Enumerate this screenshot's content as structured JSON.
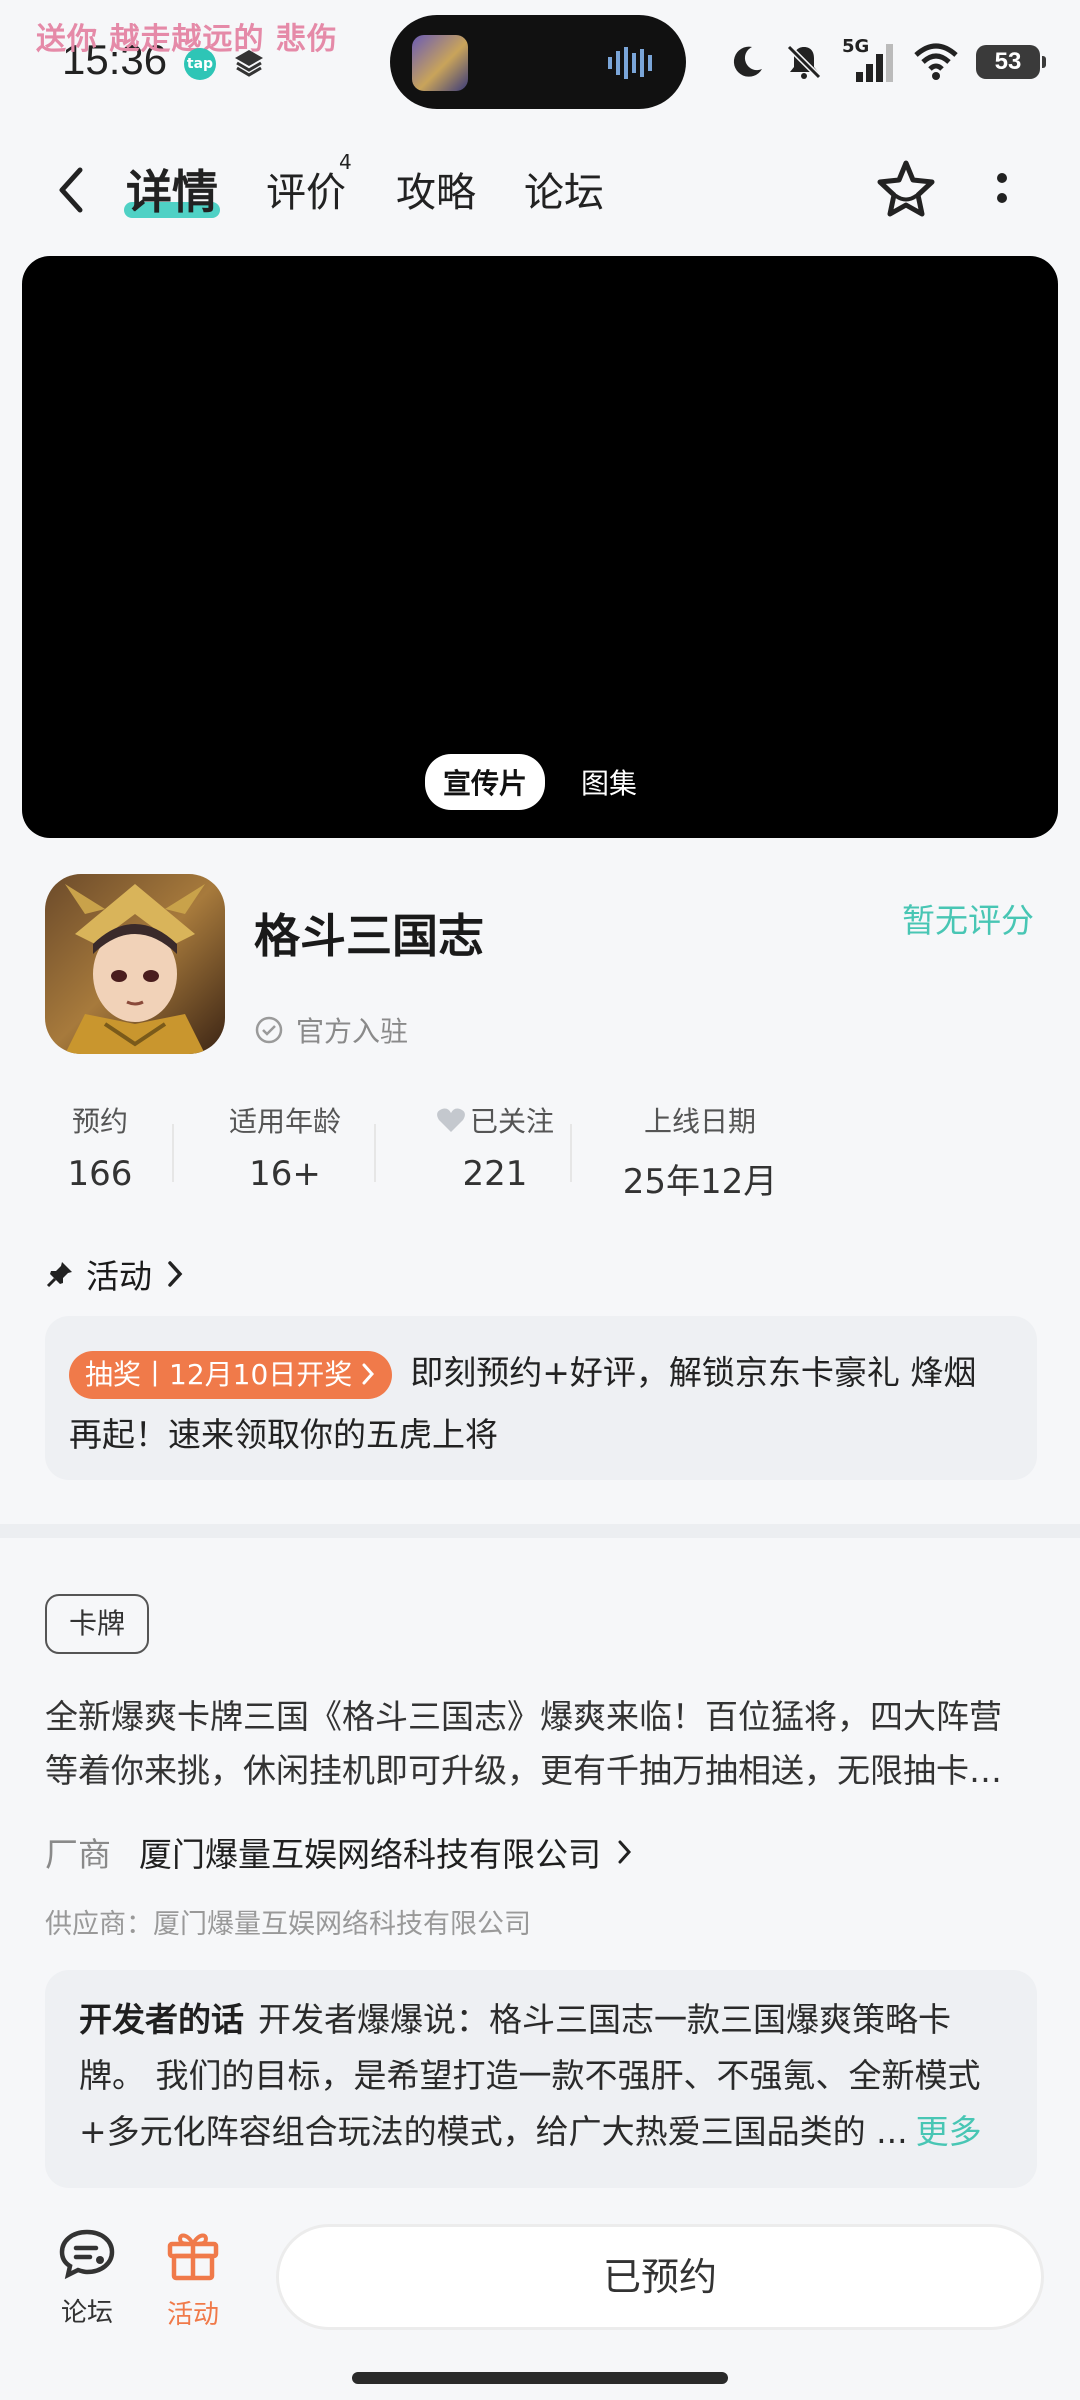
{
  "status_bar": {
    "lyric": "送你 越走越远的 悲伤",
    "time": "15:36",
    "tap_badge": "tap",
    "network": "5G",
    "battery": "53"
  },
  "nav": {
    "tabs": [
      {
        "label": "详情"
      },
      {
        "label": "评价"
      },
      {
        "label": "攻略"
      },
      {
        "label": "论坛"
      }
    ],
    "review_count": "4"
  },
  "media": {
    "tabs": [
      "宣传片",
      "图集"
    ]
  },
  "game": {
    "title": "格斗三国志",
    "rating": "暂无评分",
    "official": "官方入驻"
  },
  "stats": [
    {
      "label": "预约",
      "value": "166"
    },
    {
      "label": "适用年龄",
      "value": "16+"
    },
    {
      "label": "已关注",
      "value": "221"
    },
    {
      "label": "上线日期",
      "value": "25年12月"
    }
  ],
  "activity": {
    "heading": "活动",
    "pill": "抽奖丨12月10日开奖",
    "line1": "即刻预约+好评，解锁京东卡豪礼 烽烟",
    "line2": "再起！速来领取你的五虎上将"
  },
  "details": {
    "tag": "卡牌",
    "desc_line1": "全新爆爽卡牌三国《格斗三国志》爆爽来临！百位猛将，四大阵营",
    "desc_line2": "等着你来挑，休闲挂机即可升级，更有千抽万抽相送，无限抽卡…",
    "vendor_label": "厂商",
    "vendor_name": "厦门爆量互娱网络科技有限公司",
    "supplier": "供应商：厦门爆量互娱网络科技有限公司"
  },
  "developer": {
    "title": "开发者的话",
    "line1": "开发者爆爆说：格斗三国志一款三国爆爽策略卡",
    "line2": "牌。 我们的目标，是希望打造一款不强肝、不强氪、全新模式",
    "line3": "+多元化阵容组合玩法的模式，给广大热爱三国品类的 ...",
    "more": "更多"
  },
  "bottom": {
    "forum": "论坛",
    "activity": "活动",
    "reserve": "已预约"
  },
  "colors": {
    "accent": "#48c6b4",
    "tab_underline": "#4fd1c5",
    "activity_orange": "#f07a4a",
    "lyric_pink": "#e58aa8"
  }
}
